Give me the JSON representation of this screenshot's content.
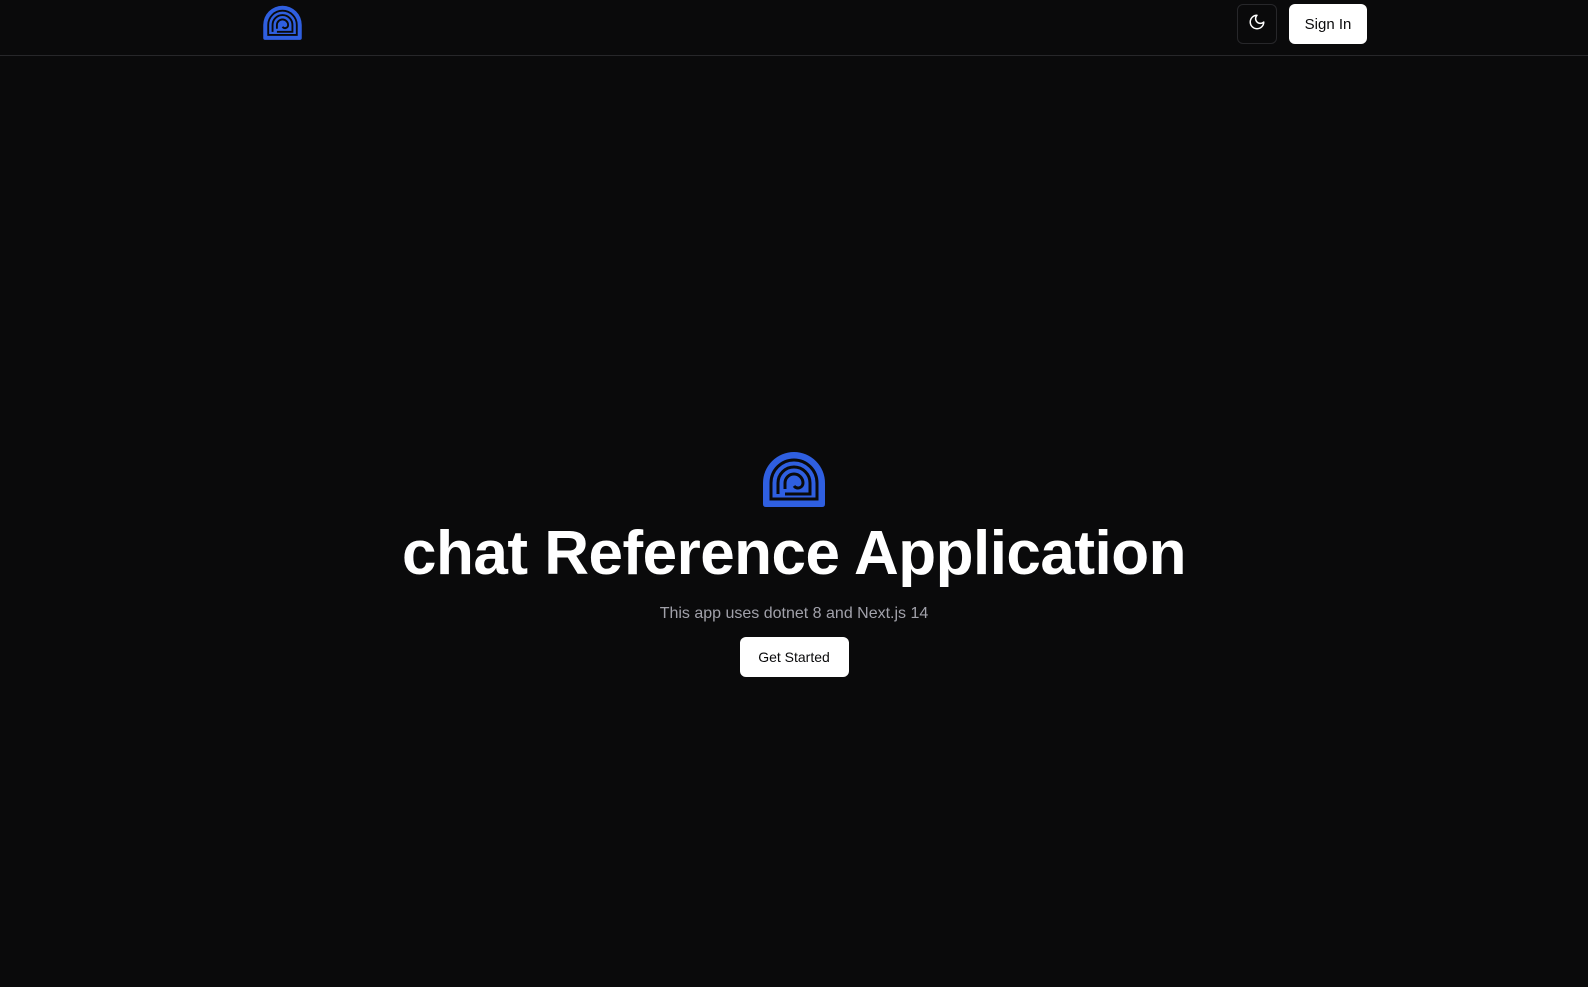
{
  "header": {
    "logo_icon": "spiral-logo-icon",
    "theme_toggle_icon": "moon-icon",
    "sign_in_label": "Sign In"
  },
  "hero": {
    "logo_icon": "spiral-logo-icon",
    "title": "chat Reference Application",
    "subtitle": "This app uses dotnet 8 and Next.js 14",
    "cta_label": "Get Started"
  },
  "colors": {
    "background": "#0a0a0b",
    "brand": "#2f5fe0",
    "button_bg": "#ffffff",
    "button_text": "#0a0a0b",
    "subtitle": "#a1a1aa",
    "border": "#27272a"
  }
}
